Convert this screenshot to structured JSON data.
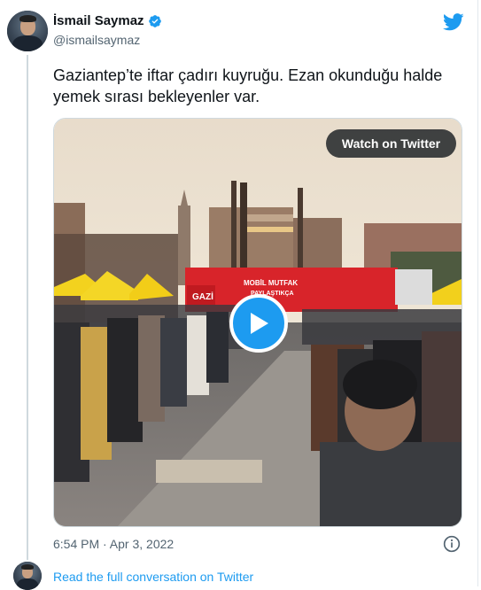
{
  "author": {
    "name": "İsmail Saymaz",
    "handle": "@ismailsaymaz",
    "verified_icon": "verified-badge-icon"
  },
  "brand": {
    "icon": "twitter-bird-icon",
    "accent": "#1d9bf0"
  },
  "tweet": {
    "text": "Gaziantep’te iftar çadırı kuyruğu. Ezan okunduğu halde yemek sırası bekleyenler var.",
    "timestamp": "6:54 PM · Apr 3, 2022"
  },
  "media": {
    "watch_label": "Watch on Twitter",
    "play_icon": "play-icon",
    "truck_sign": "MOBİL MUTFAK",
    "truck_sign_2": "PAYLAŞTIKÇA",
    "truck_brand": "GAZİ"
  },
  "footer": {
    "read_link": "Read the full conversation on Twitter",
    "info_icon": "info-icon"
  }
}
